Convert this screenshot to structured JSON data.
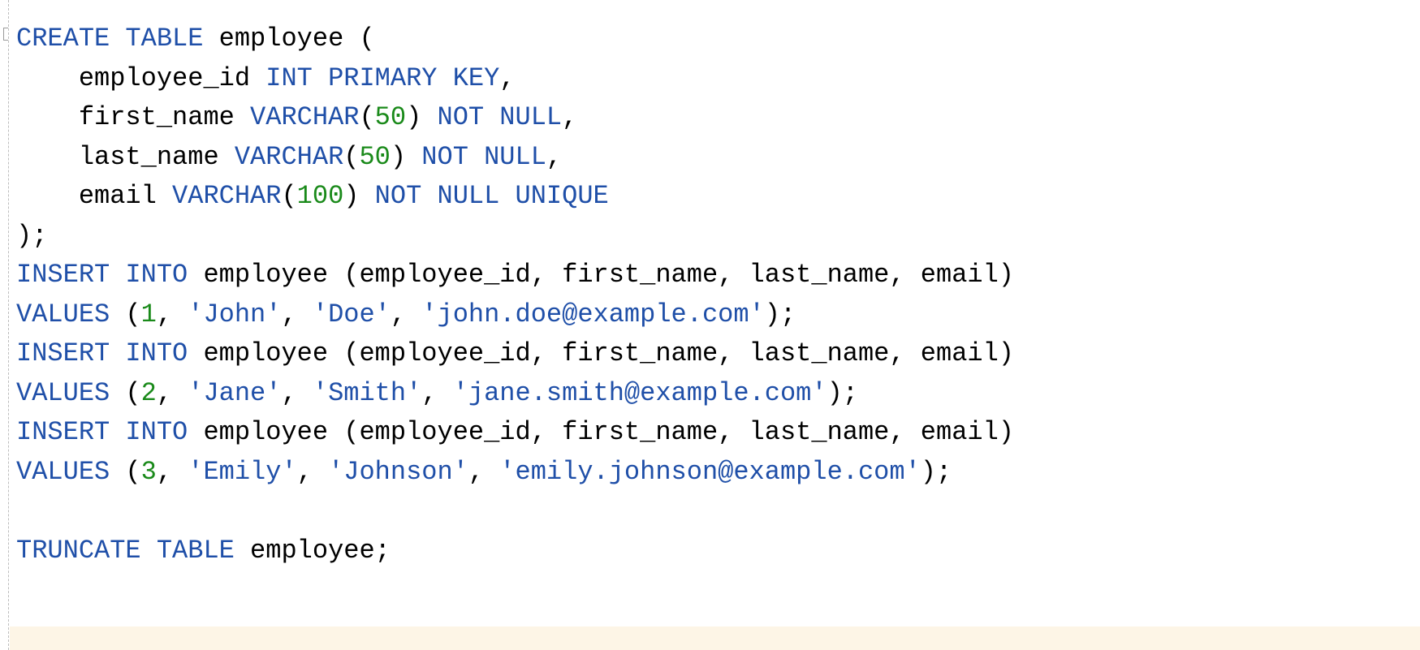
{
  "editor": {
    "lines": [
      [
        {
          "t": "CREATE",
          "k": "kw"
        },
        {
          "t": " ",
          "k": "id"
        },
        {
          "t": "TABLE",
          "k": "kw"
        },
        {
          "t": " employee ",
          "k": "id"
        },
        {
          "t": "(",
          "k": "pun"
        }
      ],
      [
        {
          "t": "    employee_id ",
          "k": "id"
        },
        {
          "t": "INT",
          "k": "kw"
        },
        {
          "t": " ",
          "k": "id"
        },
        {
          "t": "PRIMARY",
          "k": "kw"
        },
        {
          "t": " ",
          "k": "id"
        },
        {
          "t": "KEY",
          "k": "kw"
        },
        {
          "t": ",",
          "k": "pun"
        }
      ],
      [
        {
          "t": "    first_name ",
          "k": "id"
        },
        {
          "t": "VARCHAR",
          "k": "kw"
        },
        {
          "t": "(",
          "k": "pun"
        },
        {
          "t": "50",
          "k": "num"
        },
        {
          "t": ")",
          "k": "pun"
        },
        {
          "t": " ",
          "k": "id"
        },
        {
          "t": "NOT",
          "k": "kw"
        },
        {
          "t": " ",
          "k": "id"
        },
        {
          "t": "NULL",
          "k": "kw"
        },
        {
          "t": ",",
          "k": "pun"
        }
      ],
      [
        {
          "t": "    last_name ",
          "k": "id"
        },
        {
          "t": "VARCHAR",
          "k": "kw"
        },
        {
          "t": "(",
          "k": "pun"
        },
        {
          "t": "50",
          "k": "num"
        },
        {
          "t": ")",
          "k": "pun"
        },
        {
          "t": " ",
          "k": "id"
        },
        {
          "t": "NOT",
          "k": "kw"
        },
        {
          "t": " ",
          "k": "id"
        },
        {
          "t": "NULL",
          "k": "kw"
        },
        {
          "t": ",",
          "k": "pun"
        }
      ],
      [
        {
          "t": "    email ",
          "k": "id"
        },
        {
          "t": "VARCHAR",
          "k": "kw"
        },
        {
          "t": "(",
          "k": "pun"
        },
        {
          "t": "100",
          "k": "num"
        },
        {
          "t": ")",
          "k": "pun"
        },
        {
          "t": " ",
          "k": "id"
        },
        {
          "t": "NOT",
          "k": "kw"
        },
        {
          "t": " ",
          "k": "id"
        },
        {
          "t": "NULL",
          "k": "kw"
        },
        {
          "t": " ",
          "k": "id"
        },
        {
          "t": "UNIQUE",
          "k": "kw"
        }
      ],
      [
        {
          "t": ");",
          "k": "pun"
        }
      ],
      [
        {
          "t": "INSERT",
          "k": "kw"
        },
        {
          "t": " ",
          "k": "id"
        },
        {
          "t": "INTO",
          "k": "kw"
        },
        {
          "t": " employee (employee_id, first_name, last_name, email)",
          "k": "id"
        }
      ],
      [
        {
          "t": "VALUES",
          "k": "kw"
        },
        {
          "t": " (",
          "k": "pun"
        },
        {
          "t": "1",
          "k": "num"
        },
        {
          "t": ", ",
          "k": "pun"
        },
        {
          "t": "'John'",
          "k": "str"
        },
        {
          "t": ", ",
          "k": "pun"
        },
        {
          "t": "'Doe'",
          "k": "str"
        },
        {
          "t": ", ",
          "k": "pun"
        },
        {
          "t": "'john.doe@example.com'",
          "k": "str"
        },
        {
          "t": ");",
          "k": "pun"
        }
      ],
      [
        {
          "t": "INSERT",
          "k": "kw"
        },
        {
          "t": " ",
          "k": "id"
        },
        {
          "t": "INTO",
          "k": "kw"
        },
        {
          "t": " employee (employee_id, first_name, last_name, email)",
          "k": "id"
        }
      ],
      [
        {
          "t": "VALUES",
          "k": "kw"
        },
        {
          "t": " (",
          "k": "pun"
        },
        {
          "t": "2",
          "k": "num"
        },
        {
          "t": ", ",
          "k": "pun"
        },
        {
          "t": "'Jane'",
          "k": "str"
        },
        {
          "t": ", ",
          "k": "pun"
        },
        {
          "t": "'Smith'",
          "k": "str"
        },
        {
          "t": ", ",
          "k": "pun"
        },
        {
          "t": "'jane.smith@example.com'",
          "k": "str"
        },
        {
          "t": ");",
          "k": "pun"
        }
      ],
      [
        {
          "t": "INSERT",
          "k": "kw"
        },
        {
          "t": " ",
          "k": "id"
        },
        {
          "t": "INTO",
          "k": "kw"
        },
        {
          "t": " employee (employee_id, first_name, last_name, email)",
          "k": "id"
        }
      ],
      [
        {
          "t": "VALUES",
          "k": "kw"
        },
        {
          "t": " (",
          "k": "pun"
        },
        {
          "t": "3",
          "k": "num"
        },
        {
          "t": ", ",
          "k": "pun"
        },
        {
          "t": "'Emily'",
          "k": "str"
        },
        {
          "t": ", ",
          "k": "pun"
        },
        {
          "t": "'Johnson'",
          "k": "str"
        },
        {
          "t": ", ",
          "k": "pun"
        },
        {
          "t": "'emily.johnson@example.com'",
          "k": "str"
        },
        {
          "t": ");",
          "k": "pun"
        }
      ],
      [],
      [
        {
          "t": "TRUNCATE",
          "k": "kw"
        },
        {
          "t": " ",
          "k": "id"
        },
        {
          "t": "TABLE",
          "k": "kw"
        },
        {
          "t": " employee;",
          "k": "id"
        }
      ]
    ]
  },
  "colors": {
    "keyword": "#1f4fa8",
    "number": "#1a8a1a",
    "string": "#1f4fa8",
    "current_line": "#fdf5e6"
  },
  "icons": {
    "fold": "fold-collapse-icon"
  }
}
